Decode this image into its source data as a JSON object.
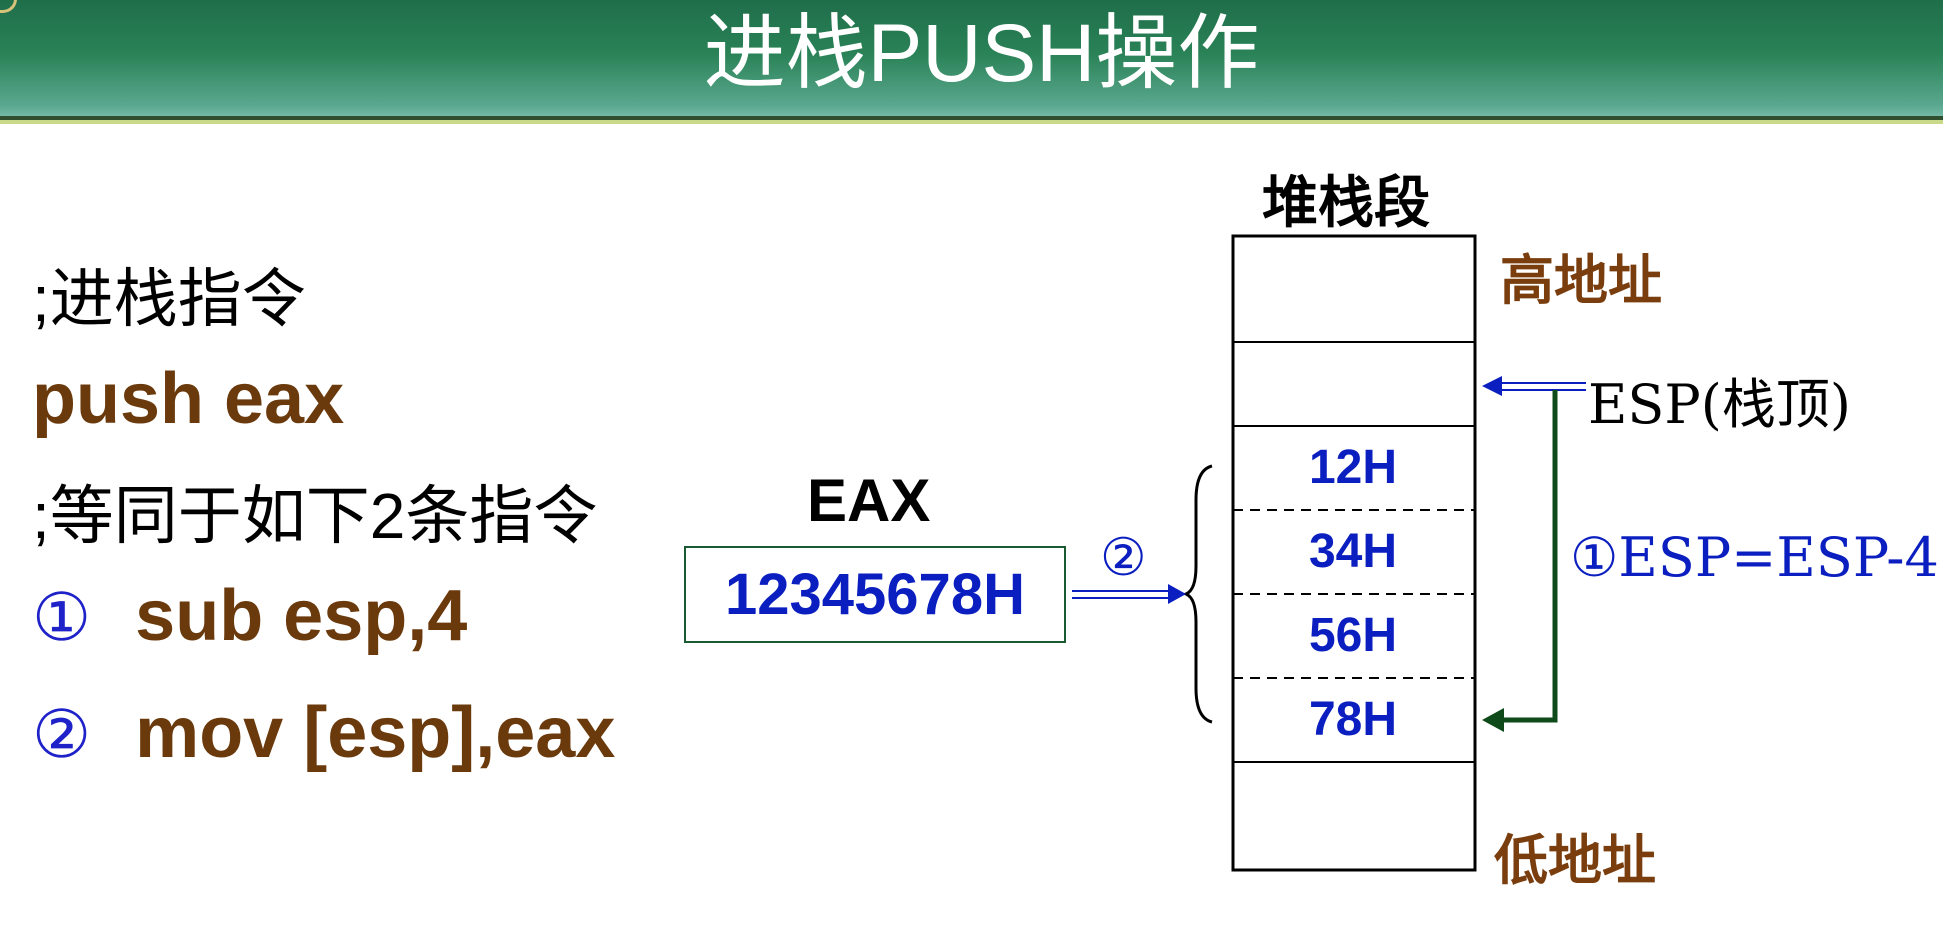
{
  "title": "进栈PUSH操作",
  "left": {
    "comment1": ";进栈指令",
    "instruction": "push eax",
    "comment2": ";等同于如下2条指令",
    "step1_num": "①",
    "step1_code": "sub esp,4",
    "step2_num": "②",
    "step2_code": "mov [esp],eax"
  },
  "register": {
    "label": "EAX",
    "value": "12345678H"
  },
  "stack": {
    "title": "堆栈段",
    "high_label": "高地址",
    "low_label": "低地址",
    "bytes": [
      "12H",
      "34H",
      "56H",
      "78H"
    ],
    "esp_label": "ESP(栈顶)",
    "step1_annotation": "①ESP=ESP-4",
    "step2_annotation": "②"
  },
  "colors": {
    "header": "#2a8257",
    "code": "#6b3a0c",
    "blue": "#0b1fc0",
    "green_arrow": "#0f4a1a",
    "address_label": "#7a3e0e"
  }
}
